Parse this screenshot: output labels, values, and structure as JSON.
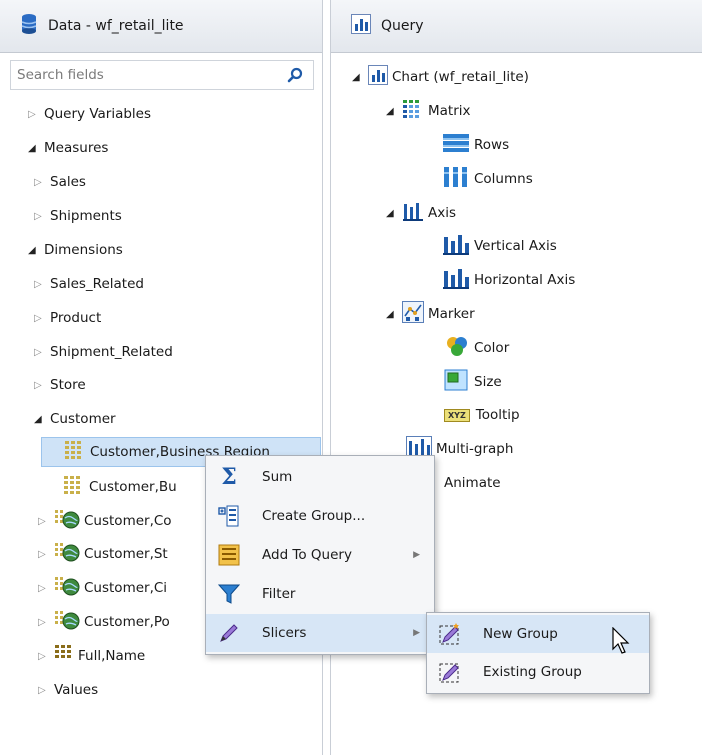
{
  "left_panel": {
    "title": "Data - wf_retail_lite",
    "search": {
      "placeholder": "Search fields"
    },
    "tree": {
      "query_variables": "Query Variables",
      "measures": "Measures",
      "sales": "Sales",
      "shipments": "Shipments",
      "dimensions": "Dimensions",
      "sales_related": "Sales_Related",
      "product": "Product",
      "shipment_related": "Shipment_Related",
      "store": "Store",
      "customer": "Customer",
      "cust_business_region": "Customer,Business Region",
      "cust_bu": "Customer,Bu",
      "cust_co": "Customer,Co",
      "cust_st": "Customer,St",
      "cust_ci": "Customer,Ci",
      "cust_po": "Customer,Po",
      "full_name": "Full,Name",
      "values": "Values"
    }
  },
  "right_panel": {
    "title": "Query",
    "tree": {
      "chart": "Chart (wf_retail_lite)",
      "matrix": "Matrix",
      "rows": "Rows",
      "columns": "Columns",
      "axis": "Axis",
      "vertical_axis": "Vertical Axis",
      "horizontal_axis": "Horizontal Axis",
      "marker": "Marker",
      "color": "Color",
      "size": "Size",
      "tooltip": "Tooltip",
      "multi_graph": "Multi-graph",
      "animate": "Animate"
    }
  },
  "context_menu": {
    "sum": "Sum",
    "create_group": "Create Group...",
    "add_to_query": "Add To Query",
    "filter": "Filter",
    "slicers": "Slicers"
  },
  "submenu": {
    "new_group": "New Group",
    "existing_group": "Existing Group"
  },
  "icons": {
    "xyz_label": "XYZ"
  },
  "colors": {
    "selection": "#cfe3f7",
    "hover": "#d7e6f6",
    "icon_blue": "#1f5aa8"
  }
}
